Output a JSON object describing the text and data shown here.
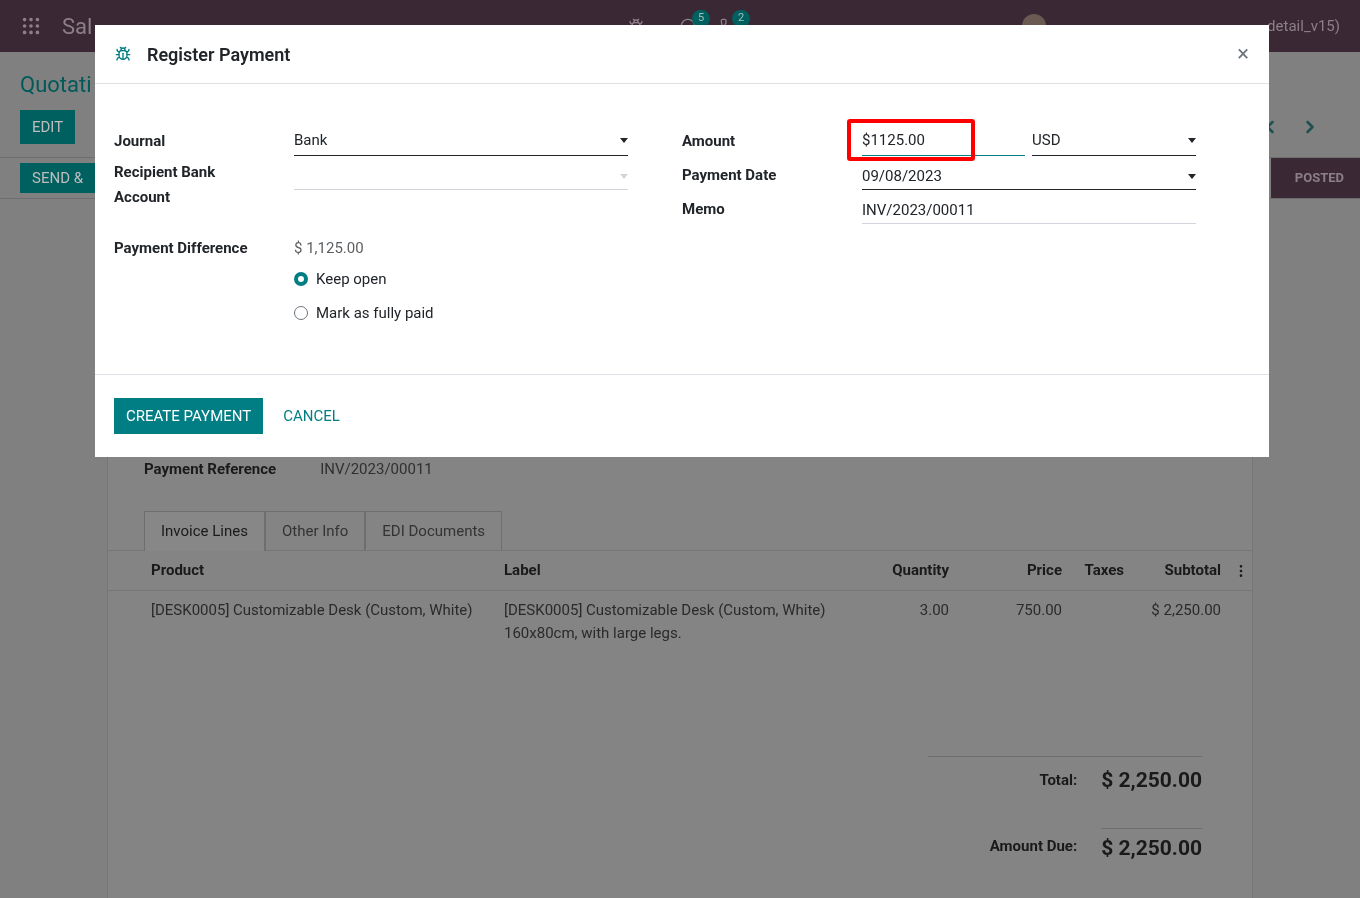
{
  "topbar": {
    "app": "Sal",
    "badges": [
      "5",
      "2"
    ],
    "user": "detail_v15)"
  },
  "page": {
    "breadcrumb": "Quotati",
    "edit": "EDIT",
    "send": "SEND &",
    "status": "POSTED",
    "payment_reference_label": "Payment Reference",
    "payment_reference": "INV/2023/00011",
    "tabs": [
      {
        "label": "Invoice Lines",
        "selected": true
      },
      {
        "label": "Other Info",
        "selected": false
      },
      {
        "label": "EDI Documents",
        "selected": false
      }
    ],
    "columns": [
      "Product",
      "Label",
      "Quantity",
      "Price",
      "Taxes",
      "Subtotal"
    ],
    "rows": [
      {
        "product": "[DESK0005] Customizable Desk (Custom, White)",
        "label": "[DESK0005] Customizable Desk (Custom, White) 160x80cm, with large legs.",
        "quantity": "3.00",
        "price": "750.00",
        "subtotal": "$ 2,250.00"
      }
    ],
    "total_label": "Total:",
    "total": "$ 2,250.00",
    "due_label": "Amount Due:",
    "due": "$ 2,250.00"
  },
  "dialog": {
    "title": "Register Payment",
    "close": "×",
    "journal_label": "Journal",
    "journal": "Bank",
    "recipient_label": "Recipient Bank Account",
    "difference_label": "Payment Difference",
    "difference": "$ 1,125.00",
    "options": [
      {
        "label": "Keep open",
        "selected": true
      },
      {
        "label": "Mark as fully paid",
        "selected": false
      }
    ],
    "amount_label": "Amount",
    "amount": "$1125.00",
    "currency": "USD",
    "date_label": "Payment Date",
    "date": "09/08/2023",
    "memo_label": "Memo",
    "memo": "INV/2023/00011",
    "create": "CREATE PAYMENT",
    "cancel": "CANCEL"
  }
}
